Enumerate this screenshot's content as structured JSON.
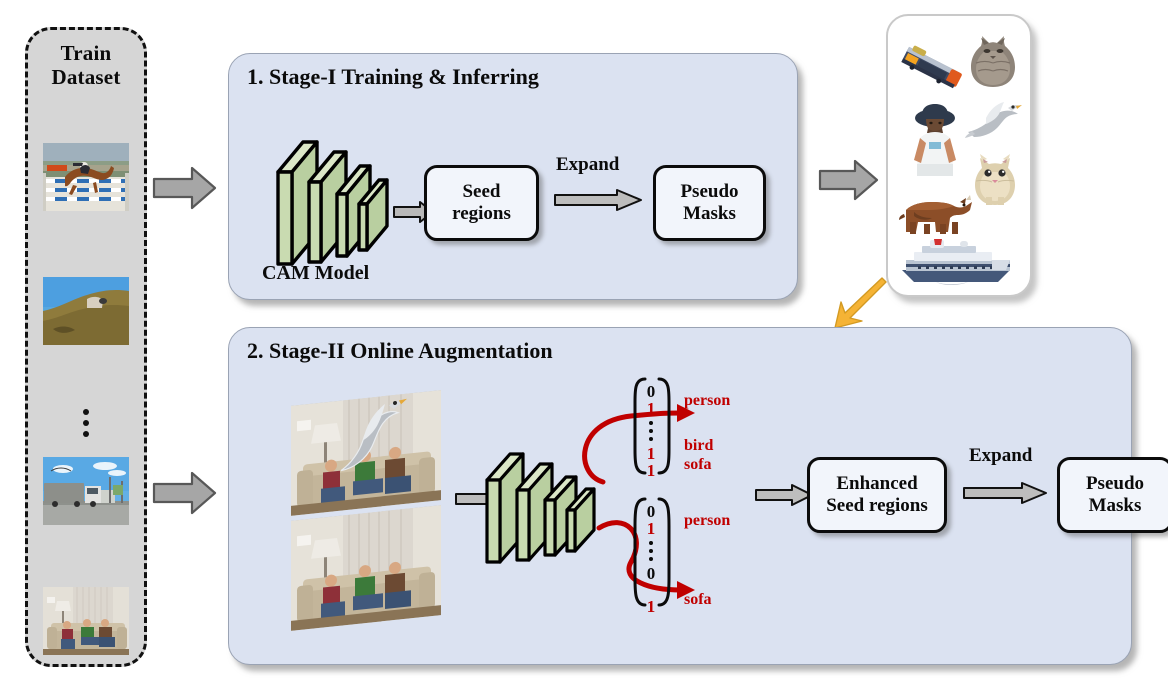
{
  "dataset": {
    "title_line1": "Train",
    "title_line2": "Dataset",
    "items": [
      {
        "name": "horse-jumping-photo"
      },
      {
        "name": "sheep-hill-photo"
      },
      {
        "name": "ellipsis"
      },
      {
        "name": "truck-street-photo"
      },
      {
        "name": "people-sofa-photo"
      }
    ]
  },
  "stage1": {
    "title": "1. Stage-I Training  & Inferring",
    "model_label": "CAM Model",
    "seed_box": "Seed\nregions",
    "seed_box_line1": "Seed",
    "seed_box_line2": "regions",
    "expand_label": "Expand",
    "pseudo_box_line1": "Pseudo",
    "pseudo_box_line2": "Masks"
  },
  "stage2": {
    "title": "2. Stage-II Online Augmentation",
    "enhanced_box_line1": "Enhanced",
    "enhanced_box_line2": "Seed regions",
    "expand_label": "Expand",
    "pseudo_box_line1": "Pseudo",
    "pseudo_box_line2": "Masks",
    "vectors": [
      {
        "name": "augmented-label-vector",
        "values": [
          "0",
          "1",
          "⋮",
          "⋮",
          "1",
          "1"
        ],
        "value_colors": [
          "dark",
          "red",
          "dark",
          "dark",
          "red",
          "red"
        ],
        "labels": [
          {
            "text": "person",
            "row": 1
          },
          {
            "text": "bird",
            "row": 4
          },
          {
            "text": "sofa",
            "row": 5
          }
        ]
      },
      {
        "name": "original-label-vector",
        "values": [
          "0",
          "1",
          "⋮",
          "⋮",
          "0",
          "1"
        ],
        "value_colors": [
          "dark",
          "red",
          "dark",
          "dark",
          "dark",
          "red"
        ],
        "labels": [
          {
            "text": "person",
            "row": 1
          },
          {
            "text": "sofa",
            "row": 5
          }
        ]
      }
    ],
    "photos": [
      {
        "name": "sofa-with-pasted-bird-photo"
      },
      {
        "name": "sofa-original-photo"
      }
    ]
  },
  "objects_panel": {
    "name": "object-bank-panel",
    "objects": [
      {
        "name": "train-object"
      },
      {
        "name": "cat-object"
      },
      {
        "name": "person-object"
      },
      {
        "name": "bird-object"
      },
      {
        "name": "kitten-object"
      },
      {
        "name": "cow-object"
      },
      {
        "name": "ship-object"
      }
    ]
  },
  "colors": {
    "panel_blue": "#dbe2f1",
    "panel_gray": "#d6d6d6",
    "accent_red": "#c00000",
    "accent_orange": "#f5b335",
    "network_green": "#c3d6a5",
    "arrow_gray": "#a6a6a6"
  }
}
